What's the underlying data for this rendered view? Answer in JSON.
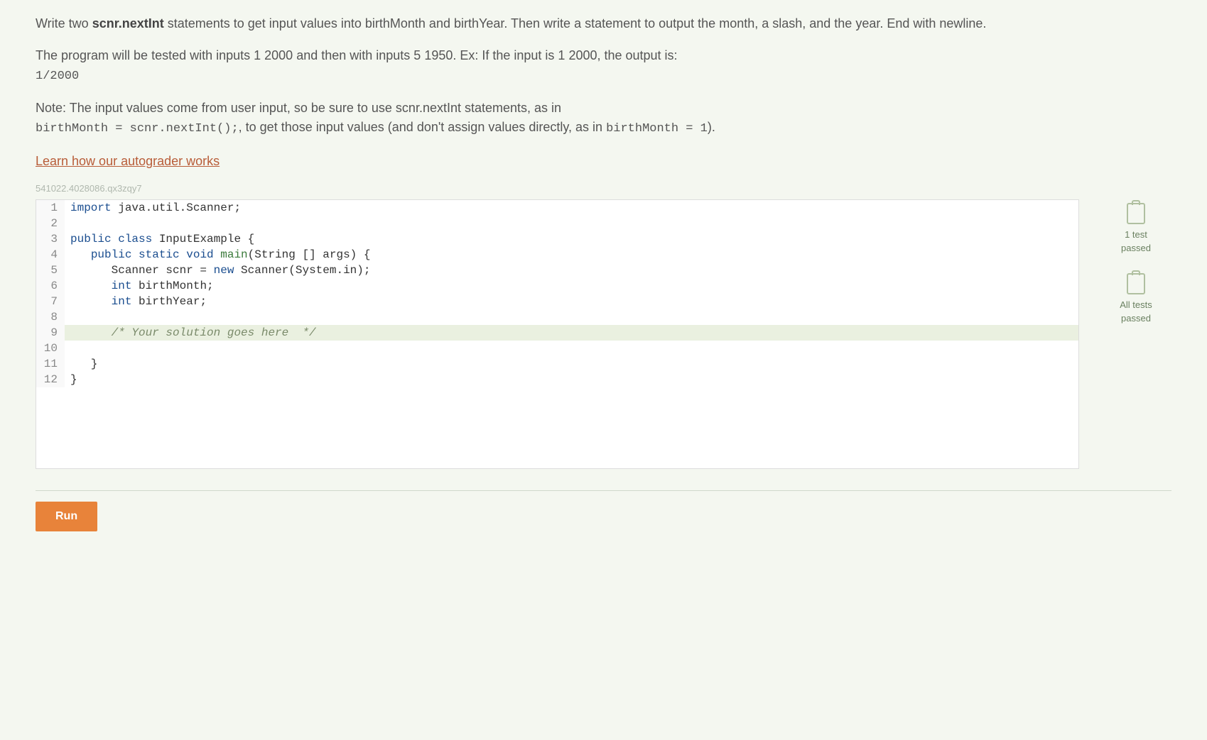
{
  "instructions": {
    "p1_a": "Write two ",
    "p1_bold": "scnr.nextInt",
    "p1_b": " statements to get input values into birthMonth and birthYear. Then write a statement to output the month, a slash, and the year. End with newline.",
    "p2_a": "The program will be tested with inputs 1 2000 and then with inputs 5 1950. Ex: If the input is 1 2000, the output is:",
    "p2_mono": "1/2000",
    "p3_a": "Note: The input values come from user input, so be sure to use scnr.nextInt statements, as in",
    "p3_mono1": "birthMonth = scnr.nextInt();",
    "p3_b": ", to get those input values (and don't assign values directly, as in ",
    "p3_mono2": "birthMonth = 1",
    "p3_c": ")."
  },
  "autograder_link": "Learn how our autograder works",
  "watermark": "541022.4028086.qx3zqy7",
  "code": {
    "lines": [
      {
        "n": "1",
        "segments": [
          {
            "t": "import",
            "c": "kw-blue"
          },
          {
            "t": " java.util.Scanner;",
            "c": ""
          }
        ]
      },
      {
        "n": "2",
        "segments": []
      },
      {
        "n": "3",
        "segments": [
          {
            "t": "public class ",
            "c": "kw-blue"
          },
          {
            "t": "InputExample {",
            "c": ""
          }
        ]
      },
      {
        "n": "4",
        "segments": [
          {
            "t": "   ",
            "c": ""
          },
          {
            "t": "public static void ",
            "c": "kw-blue"
          },
          {
            "t": "main",
            "c": "kw-green"
          },
          {
            "t": "(String [] args) {",
            "c": ""
          }
        ]
      },
      {
        "n": "5",
        "segments": [
          {
            "t": "      Scanner scnr = ",
            "c": ""
          },
          {
            "t": "new",
            "c": "kw-blue"
          },
          {
            "t": " Scanner(System.in);",
            "c": ""
          }
        ]
      },
      {
        "n": "6",
        "segments": [
          {
            "t": "      ",
            "c": ""
          },
          {
            "t": "int",
            "c": "kw-blue"
          },
          {
            "t": " birthMonth;",
            "c": ""
          }
        ]
      },
      {
        "n": "7",
        "segments": [
          {
            "t": "      ",
            "c": ""
          },
          {
            "t": "int",
            "c": "kw-blue"
          },
          {
            "t": " birthYear;",
            "c": ""
          }
        ]
      },
      {
        "n": "8",
        "segments": []
      },
      {
        "n": "9",
        "highlighted": true,
        "segments": [
          {
            "t": "      ",
            "c": ""
          },
          {
            "t": "/* Your solution goes here  */",
            "c": "comment"
          }
        ]
      },
      {
        "n": "10",
        "segments": []
      },
      {
        "n": "11",
        "segments": [
          {
            "t": "   }",
            "c": ""
          }
        ]
      },
      {
        "n": "12",
        "segments": [
          {
            "t": "}",
            "c": ""
          }
        ]
      }
    ]
  },
  "status": {
    "item1": "1 test\npassed",
    "item2": "All tests\npassed"
  },
  "controls": {
    "run_label": "Run"
  }
}
